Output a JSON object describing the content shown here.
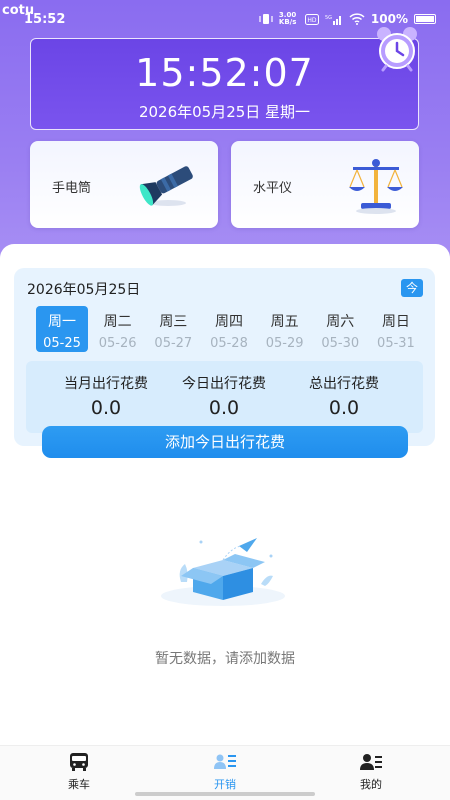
{
  "status_bar": {
    "brand": "cotu",
    "time": "15:52",
    "net_speed": "3.00 KB/s",
    "battery": "100%"
  },
  "clock": {
    "time": "15:52:07",
    "date": "2026年05月25日 星期一"
  },
  "tools": [
    {
      "label": "手电筒",
      "icon": "flashlight-icon"
    },
    {
      "label": "水平仪",
      "icon": "balance-scale-icon"
    }
  ],
  "calendar": {
    "date": "2026年05月25日",
    "today_label": "今",
    "week": [
      {
        "name": "周一",
        "date": "05-25",
        "active": true
      },
      {
        "name": "周二",
        "date": "05-26"
      },
      {
        "name": "周三",
        "date": "05-27"
      },
      {
        "name": "周四",
        "date": "05-28"
      },
      {
        "name": "周五",
        "date": "05-29"
      },
      {
        "name": "周六",
        "date": "05-30"
      },
      {
        "name": "周日",
        "date": "05-31"
      }
    ]
  },
  "stats": [
    {
      "label": "当月出行花费",
      "value": "0.0"
    },
    {
      "label": "今日出行花费",
      "value": "0.0"
    },
    {
      "label": "总出行花费",
      "value": "0.0"
    }
  ],
  "add_button": "添加今日出行花费",
  "empty_text": "暂无数据，请添加数据",
  "tabs": [
    {
      "label": "乘车",
      "icon": "bus-icon"
    },
    {
      "label": "开销",
      "icon": "expense-list-icon",
      "active": true
    },
    {
      "label": "我的",
      "icon": "profile-icon"
    }
  ],
  "colors": {
    "primary": "#2a96f0",
    "header_purple": "#7a54ee"
  }
}
